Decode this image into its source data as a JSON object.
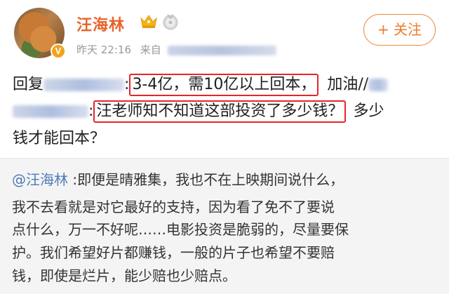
{
  "header": {
    "username": "汪海林",
    "vip_badge": "V",
    "time": "昨天 22:16",
    "source_prefix": "来自",
    "follow_label": "+ 关注",
    "accent_color": "#e8632a"
  },
  "post": {
    "line1_prefix": "回复",
    "line1_separator": ":",
    "line1_highlight": "3-4亿，需10亿以上回本，",
    "line1_suffix": "加油//",
    "line2_separator": ":",
    "line2_highlight": "汪老师知不知道这部投资了多少钱？",
    "line2_suffix": "多少",
    "line3": "钱才能回本？"
  },
  "quote": {
    "mention": "@汪海林",
    "line1_rest": " :即便是晴雅集，我也不在上映期间说什么，",
    "line2": "我不去看就是对它最好的支持，因为看了免不了要说",
    "line3": "点什么，万一不好呢……电影投资是脆弱的，尽量要保",
    "line4": "护。我们希望好片都赚钱，一般的片子也希望不要赔",
    "line5": "钱，即使是烂片，能少赔也少赔点。"
  }
}
